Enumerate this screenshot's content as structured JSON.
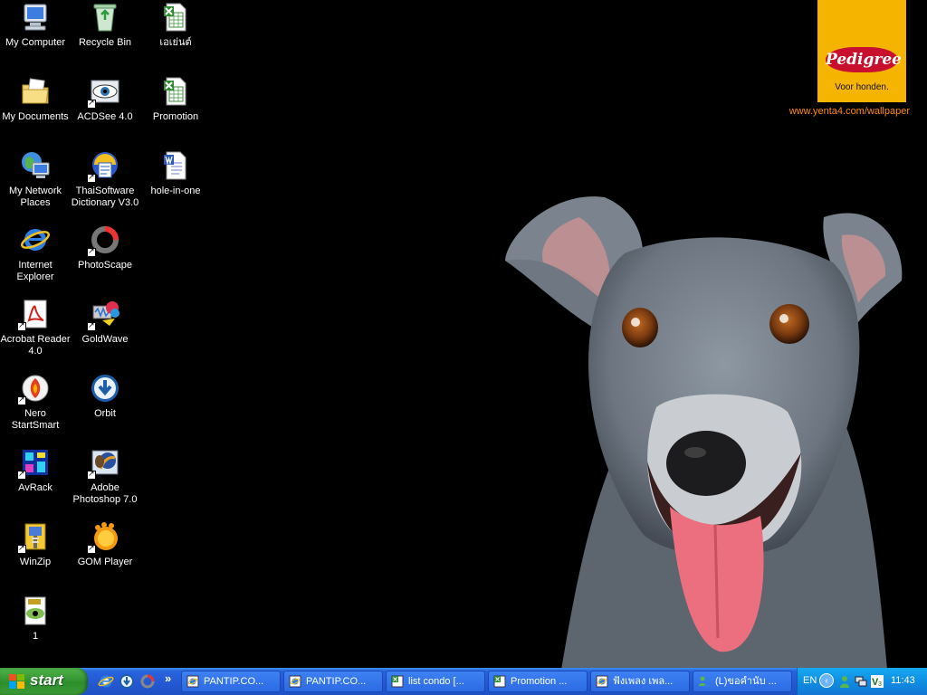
{
  "wallpaper": {
    "brand": "Pedigree",
    "tagline": "Voor honden.",
    "url": "www.yenta4.com/wallpaper"
  },
  "desktop_icons": [
    {
      "label": "My Computer",
      "icon": "my-computer-icon"
    },
    {
      "label": "Recycle Bin",
      "icon": "recycle-bin-icon"
    },
    {
      "label": "เอเย่นต์",
      "icon": "excel-file-icon"
    },
    {
      "label": "My Documents",
      "icon": "my-documents-icon"
    },
    {
      "label": "ACDSee 4.0",
      "icon": "acdsee-icon"
    },
    {
      "label": "Promotion",
      "icon": "excel-file-icon"
    },
    {
      "label": "My Network Places",
      "icon": "network-places-icon"
    },
    {
      "label": "ThaiSoftware Dictionary V3.0",
      "icon": "thaisoftware-dictionary-icon"
    },
    {
      "label": "hole-in-one",
      "icon": "word-file-icon"
    },
    {
      "label": "Internet Explorer",
      "icon": "internet-explorer-icon"
    },
    {
      "label": "PhotoScape",
      "icon": "photoscape-icon"
    },
    {
      "label": "Acrobat Reader 4.0",
      "icon": "acrobat-reader-icon"
    },
    {
      "label": "GoldWave",
      "icon": "goldwave-icon"
    },
    {
      "label": "Nero StartSmart",
      "icon": "nero-icon"
    },
    {
      "label": "Orbit",
      "icon": "orbit-icon"
    },
    {
      "label": "AvRack",
      "icon": "avrack-icon"
    },
    {
      "label": "Adobe Photoshop 7.0",
      "icon": "photoshop-icon"
    },
    {
      "label": "WinZip",
      "icon": "winzip-icon"
    },
    {
      "label": "GOM Player",
      "icon": "gom-player-icon"
    },
    {
      "label": "1",
      "icon": "jpg-file-icon"
    }
  ],
  "taskbar": {
    "start_label": "start",
    "quick_launch": [
      "internet-explorer-icon",
      "orbit-icon",
      "photoscape-icon"
    ],
    "tasks": [
      {
        "label": "PANTIP.CO...",
        "icon": "ie-window-icon"
      },
      {
        "label": "PANTIP.CO...",
        "icon": "ie-window-icon"
      },
      {
        "label": "list condo  [...",
        "icon": "excel-window-icon"
      },
      {
        "label": "Promotion  ...",
        "icon": "excel-window-icon"
      },
      {
        "label": "ฟังเพลง เพล...",
        "icon": "ie-window-icon"
      },
      {
        "label": "(L)ขอคำนับ ...",
        "icon": "msn-window-icon"
      }
    ],
    "tray": {
      "language": "EN",
      "clock": "11:43",
      "icons": [
        "msn-tray-icon",
        "network-tray-icon",
        "antivirus-tray-icon"
      ]
    }
  },
  "colors": {
    "taskbar_blue": "#245dd7",
    "start_green": "#3a9c34",
    "tray_blue": "#0f8be0",
    "url_orange": "#ff8c00",
    "brand_yellow": "#f4b400"
  }
}
